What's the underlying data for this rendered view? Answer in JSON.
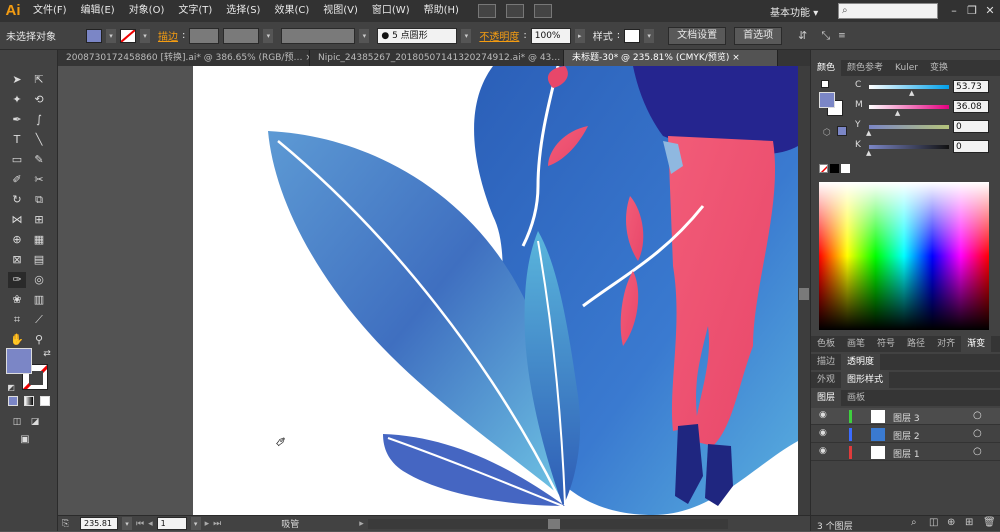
{
  "menubar": {
    "logo": "Ai",
    "items": [
      "文件(F)",
      "编辑(E)",
      "对象(O)",
      "文字(T)",
      "选择(S)",
      "效果(C)",
      "视图(V)",
      "窗口(W)",
      "帮助(H)"
    ],
    "workspace": "基本功能",
    "workspace_dropdown": "▾",
    "window_minimize": "–",
    "window_restore": "❐",
    "window_close": "✕"
  },
  "control_bar": {
    "selection_status": "未选择对象",
    "stroke_label": "描边",
    "brush_label": "5 点圆形",
    "opacity_label": "不透明度",
    "opacity_value": "100%",
    "style_label": "样式",
    "doc_settings": "文档设置",
    "preferences": "首选项"
  },
  "doc_tabs": [
    {
      "label": "20087301724588​60 [转换].ai* @ 386.65% (RGB/预…",
      "close": "×"
    },
    {
      "label": "Nipic_24385267_20180507141320274912.ai* @ 43…",
      "close": "×"
    },
    {
      "label": "未标题-30* @ 235.81% (CMYK/预览)",
      "close": "×"
    }
  ],
  "status_bar": {
    "zoom": "235.81",
    "artboard": "1",
    "tool": "吸管"
  },
  "color_panel": {
    "tabs": [
      "颜色",
      "颜色参考",
      "Kuler",
      "变换"
    ],
    "sliders": [
      {
        "label": "C",
        "value": "53.73",
        "pos": 0.537
      },
      {
        "label": "M",
        "value": "36.08",
        "pos": 0.361
      },
      {
        "label": "Y",
        "value": "0",
        "pos": 0
      },
      {
        "label": "K",
        "value": "0",
        "pos": 0
      }
    ],
    "fill_color": "#7b86c6"
  },
  "panel_tabs_2": [
    "色板",
    "画笔",
    "符号",
    "路径",
    "对齐",
    "渐变"
  ],
  "panel_tabs_3": [
    "描边",
    "透明度"
  ],
  "panel_tabs_4": [
    "外观",
    "图形样式"
  ],
  "panel_tabs_5": [
    "图层",
    "画板"
  ],
  "layers": [
    {
      "name": "图层 3",
      "color": "#3ecf3e"
    },
    {
      "name": "图层 2",
      "color": "#3b6cff"
    },
    {
      "name": "图层 1",
      "color": "#e03b3b"
    }
  ],
  "layers_footer": "3 个图层",
  "colors": {
    "accent": "#f39c12",
    "fill": "#7b86c6"
  }
}
